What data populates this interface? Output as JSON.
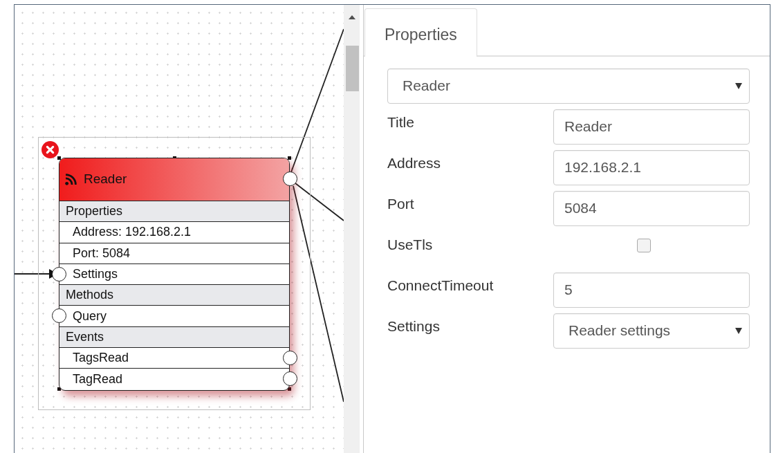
{
  "node": {
    "title": "Reader",
    "selected": true,
    "sections": [
      {
        "heading": "Properties",
        "members": [
          {
            "label": "Address: 192.168.2.1",
            "left_port": false,
            "right_port": false
          },
          {
            "label": "Port: 5084",
            "left_port": false,
            "right_port": false
          },
          {
            "label": "Settings",
            "left_port": true,
            "right_port": false
          }
        ]
      },
      {
        "heading": "Methods",
        "members": [
          {
            "label": "Query",
            "left_port": true,
            "right_port": false
          }
        ]
      },
      {
        "heading": "Events",
        "members": [
          {
            "label": "TagsRead",
            "left_port": false,
            "right_port": true
          },
          {
            "label": "TagRead",
            "left_port": false,
            "right_port": true
          }
        ]
      }
    ]
  },
  "tabs": [
    {
      "label": "Properties",
      "selected": true
    }
  ],
  "object_select": {
    "value": "Reader"
  },
  "fields": [
    {
      "kind": "text",
      "label": "Title",
      "value": "Reader"
    },
    {
      "kind": "text",
      "label": "Address",
      "value": "192.168.2.1"
    },
    {
      "kind": "text",
      "label": "Port",
      "value": "5084"
    },
    {
      "kind": "checkbox",
      "label": "UseTls",
      "checked": false
    },
    {
      "kind": "text",
      "label": "ConnectTimeout",
      "value": "5"
    },
    {
      "kind": "select",
      "label": "Settings",
      "value": "Reader settings"
    }
  ]
}
